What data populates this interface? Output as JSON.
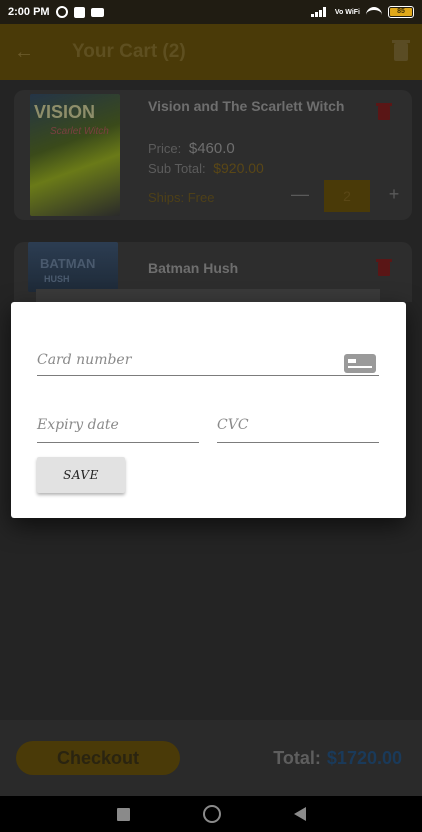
{
  "status_bar": {
    "time": "2:00 PM",
    "vowifi": "Vo WiFi",
    "battery": "85"
  },
  "app_bar": {
    "title": "Your Cart (2)"
  },
  "cart": {
    "items": [
      {
        "title": "Vision and The Scarlett Witch",
        "cover_title": "VISION",
        "cover_subtitle": "Scarlet Witch",
        "price_label": "Price:",
        "price": "$460.0",
        "subtotal_label": "Sub Total:",
        "subtotal": "$920.00",
        "ships": "Ships: Free",
        "quantity": "2",
        "minus": "—",
        "plus": "+"
      },
      {
        "title": "Batman Hush",
        "cover_title": "BATMAN",
        "cover_subtitle": "HUSH"
      }
    ]
  },
  "footer": {
    "checkout_label": "Checkout",
    "total_label": "Total:",
    "total_value": "$1720.00"
  },
  "dialog": {
    "card_number_placeholder": "Card number",
    "expiry_placeholder": "Expiry date",
    "cvc_placeholder": "CVC",
    "save_label": "SAVE"
  },
  "colors": {
    "accent": "#ffc107",
    "delete": "#d32f2f",
    "total": "#1976d2",
    "dialog_bg": "#ffffff"
  }
}
